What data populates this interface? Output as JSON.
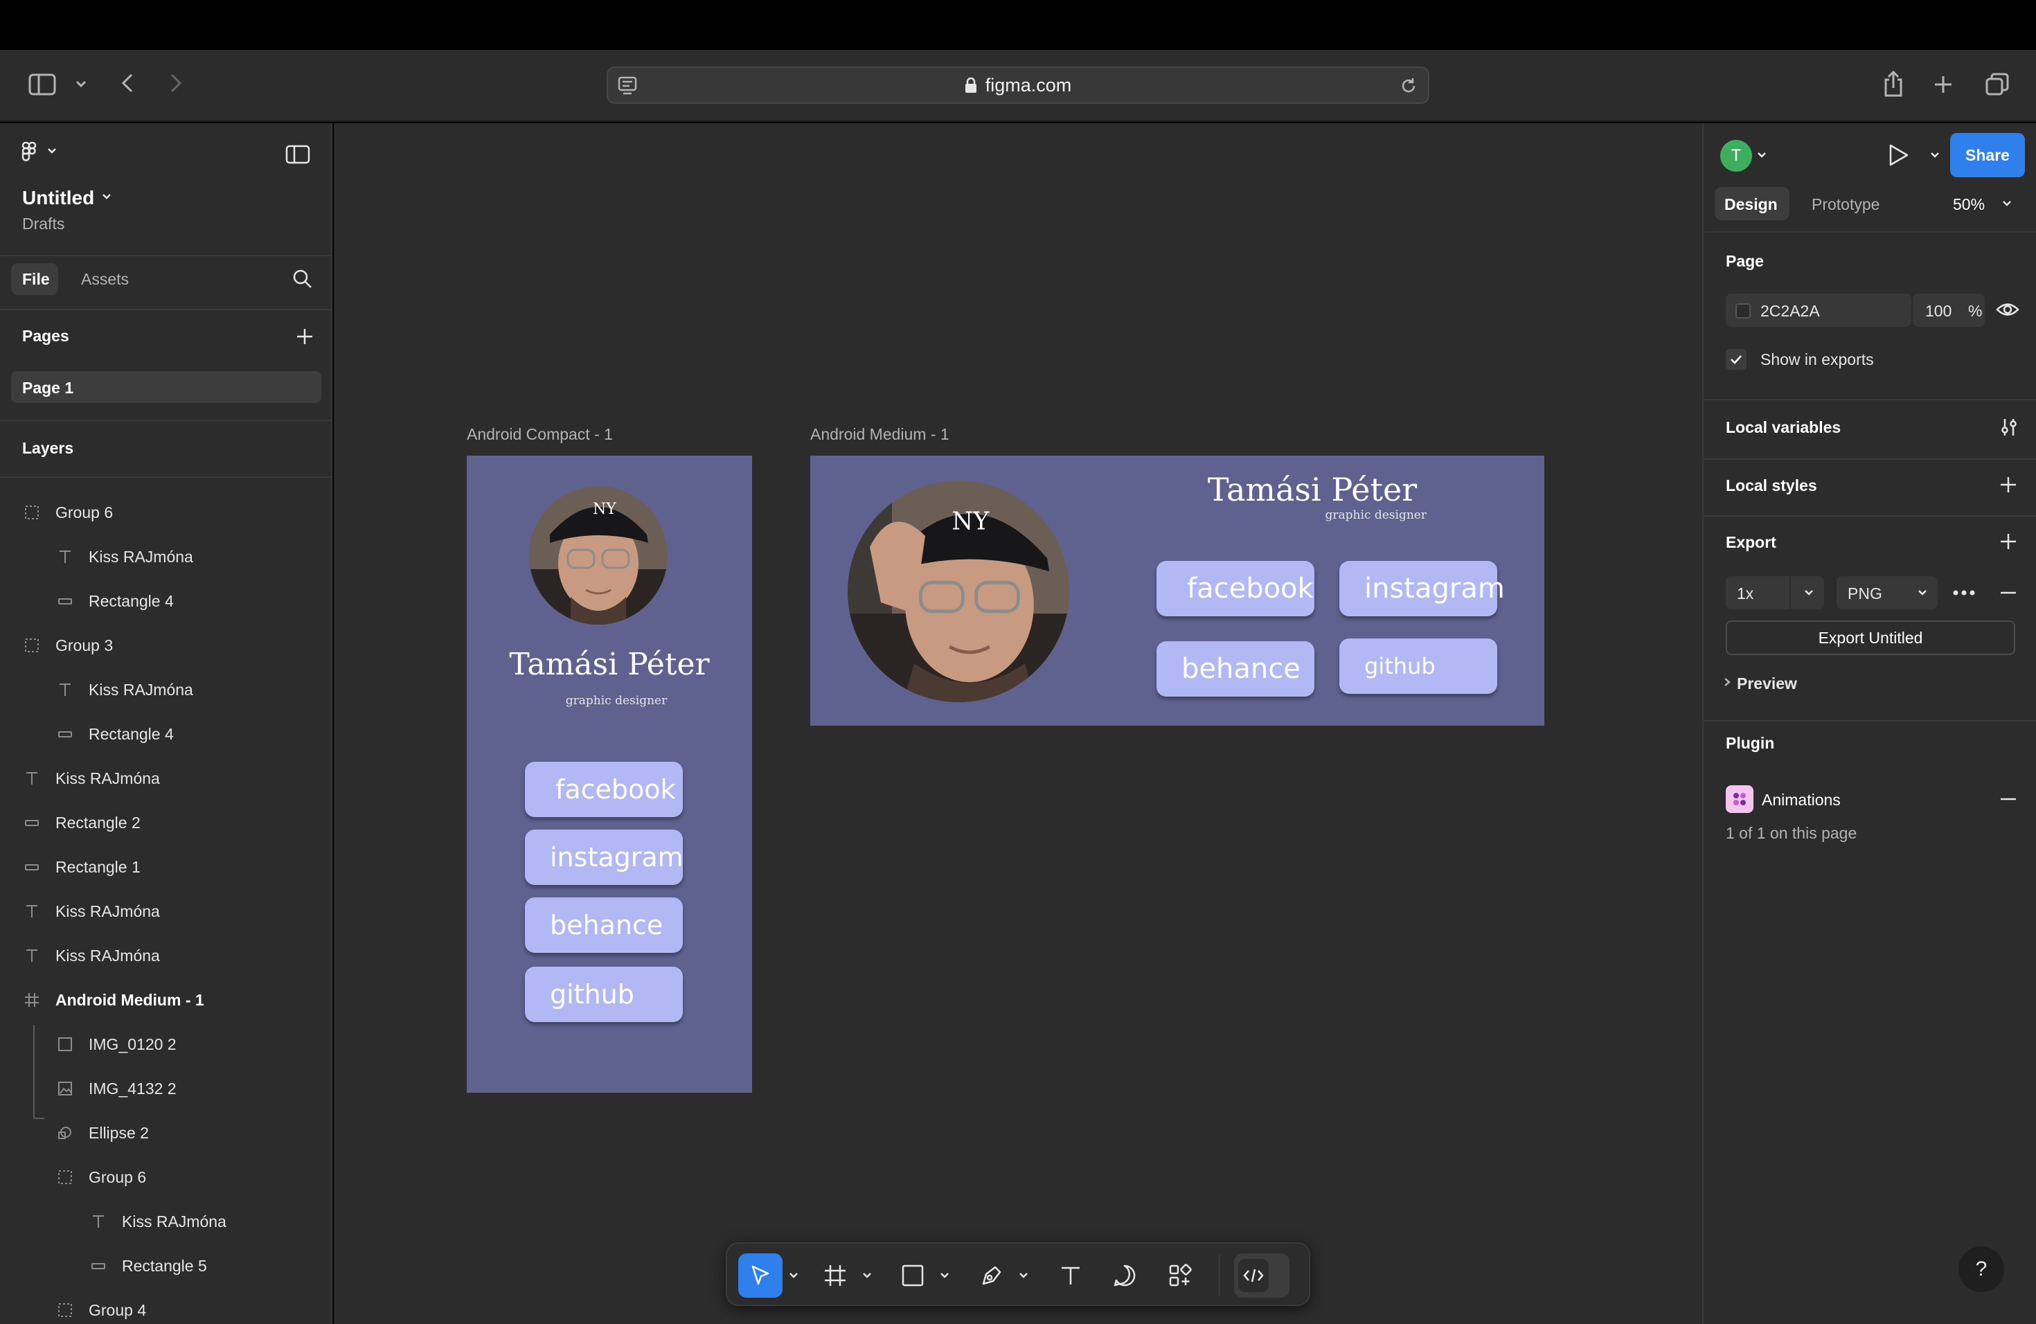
{
  "browser": {
    "url": "figma.com"
  },
  "file": {
    "title": "Untitled",
    "location": "Drafts"
  },
  "left_tabs": {
    "file": "File",
    "assets": "Assets"
  },
  "pages": {
    "heading": "Pages",
    "items": [
      "Page 1"
    ]
  },
  "layers": {
    "heading": "Layers",
    "items": [
      "Group 6",
      "Kiss RAJmóna",
      "Rectangle 4",
      "Group 3",
      "Kiss RAJmóna",
      "Rectangle 4",
      "Kiss RAJmóna",
      "Rectangle 2",
      "Rectangle 1",
      "Kiss RAJmóna",
      "Kiss RAJmóna",
      "Android Medium - 1",
      "IMG_0120 2",
      "IMG_4132 2",
      "Ellipse 2",
      "Group 6",
      "Kiss RAJmóna",
      "Rectangle 5",
      "Group 4"
    ]
  },
  "canvas": {
    "frame_compact_label": "Android Compact - 1",
    "frame_medium_label": "Android Medium - 1",
    "name": "Tamási Péter",
    "subtitle": "graphic designer",
    "buttons": [
      "facebook",
      "instagram",
      "behance",
      "github"
    ],
    "frame_color": "#5f628f",
    "pill_color": "#b1b8f3"
  },
  "right": {
    "avatar_letter": "T",
    "share": "Share",
    "tab_design": "Design",
    "tab_prototype": "Prototype",
    "zoom": "50%",
    "page_heading": "Page",
    "page_color": "2C2A2A",
    "page_opacity": "100",
    "percent": "%",
    "show_in_exports": "Show in exports",
    "local_variables": "Local variables",
    "local_styles": "Local styles",
    "export_heading": "Export",
    "export_scale": "1x",
    "export_format": "PNG",
    "export_button": "Export Untitled",
    "preview": "Preview",
    "plugin_heading": "Plugin",
    "plugin_name": "Animations",
    "plugin_count": "1 of 1 on this page",
    "help": "?"
  }
}
